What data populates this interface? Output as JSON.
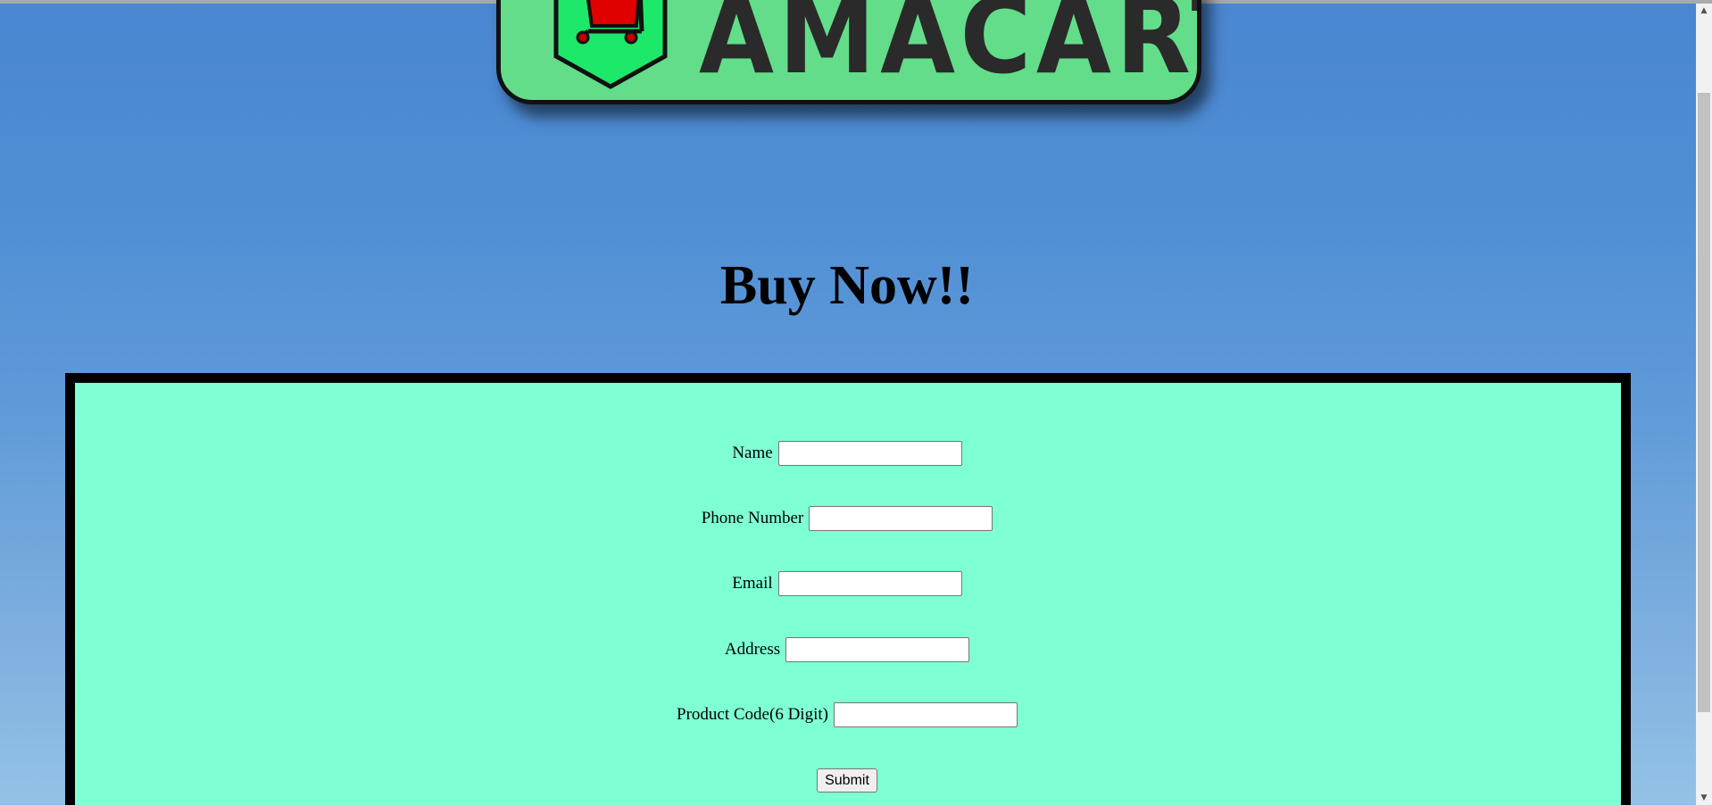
{
  "logo": {
    "text": "AMACART",
    "icon": "shopping-cart-icon"
  },
  "page": {
    "heading": "Buy Now!!"
  },
  "form": {
    "fields": [
      {
        "label": "Name",
        "value": "",
        "placeholder": ""
      },
      {
        "label": "Phone Number",
        "value": "",
        "placeholder": ""
      },
      {
        "label": "Email",
        "value": "",
        "placeholder": ""
      },
      {
        "label": "Address",
        "value": "",
        "placeholder": ""
      },
      {
        "label": "Product Code(6 Digit)",
        "value": "",
        "placeholder": ""
      }
    ],
    "submit_label": "Submit"
  },
  "scrollbar": {
    "up_icon": "scroll-up-arrow-icon",
    "down_icon": "scroll-down-arrow-icon"
  },
  "colors": {
    "background_top": "#4a86d1",
    "background_bottom": "#94c2e6",
    "form_background": "#7fffd4",
    "form_border": "#000000",
    "logo_background": "#63dd8a",
    "logo_shield": "#1ee86a",
    "cart_color": "#e00000"
  }
}
